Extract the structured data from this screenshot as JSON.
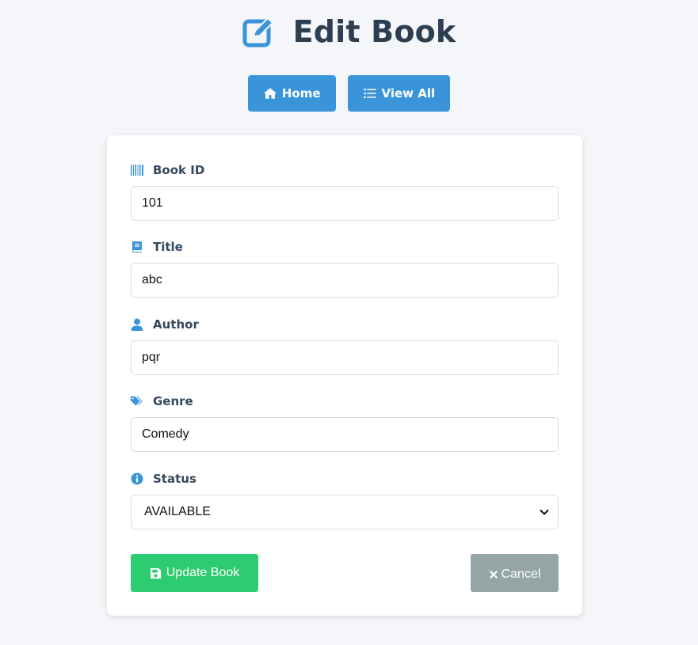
{
  "page": {
    "title": "Edit Book",
    "title_icon": "edit-icon"
  },
  "nav": {
    "home_label": "Home",
    "home_icon": "home-icon",
    "view_all_label": "View All",
    "view_all_icon": "list-icon"
  },
  "form": {
    "book_id": {
      "label": "Book ID",
      "value": "101",
      "icon": "barcode-icon"
    },
    "title": {
      "label": "Title",
      "value": "abc",
      "icon": "book-icon"
    },
    "author": {
      "label": "Author",
      "value": "pqr",
      "icon": "user-icon"
    },
    "genre": {
      "label": "Genre",
      "value": "Comedy",
      "icon": "tags-icon"
    },
    "status": {
      "label": "Status",
      "value": "AVAILABLE",
      "icon": "info-circle-icon"
    }
  },
  "actions": {
    "update_label": "Update Book",
    "update_icon": "save-icon",
    "cancel_label": "Cancel",
    "cancel_icon": "times-icon"
  },
  "colors": {
    "accent": "#3a94d9",
    "success": "#2ecc71",
    "muted": "#95a5a6",
    "heading": "#2c3e50",
    "background": "#f4f6f9"
  }
}
